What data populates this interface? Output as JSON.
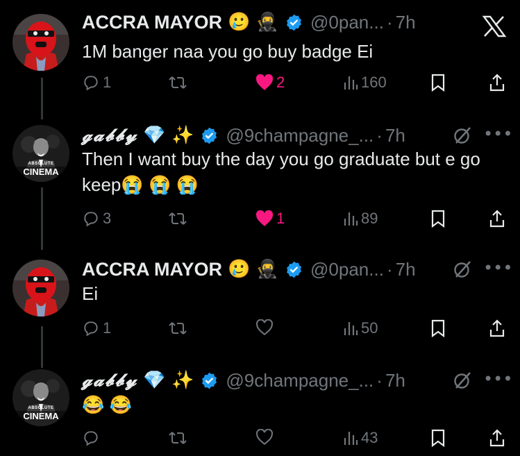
{
  "close_icon": "x-logo",
  "tweets": [
    {
      "name": "ACCRA MAYOR",
      "emojis": "🥲 🥷",
      "handle": "@0pan...",
      "dot": "·",
      "time": "7h",
      "text": "1M banger naa you go buy badge Ei",
      "replies": "1",
      "reposts": "",
      "likes": "2",
      "liked": true,
      "views": "160"
    },
    {
      "name": "𝓰𝓪𝓫𝓫𝔂",
      "emojis": "💎 ✨",
      "handle": "@9champagne_...",
      "dot": "·",
      "time": "7h",
      "text": "Then I want buy the day you go graduate but e go keep😭 😭 😭",
      "replies": "3",
      "reposts": "",
      "likes": "1",
      "liked": true,
      "views": "89",
      "avatar_caption_small": "ABSOLUTE",
      "avatar_caption": "CINEMA"
    },
    {
      "name": "ACCRA MAYOR",
      "emojis": "🥲 🥷",
      "handle": "@0pan...",
      "dot": "·",
      "time": "7h",
      "text": "Ei",
      "replies": "1",
      "reposts": "",
      "likes": "",
      "liked": false,
      "views": "50"
    },
    {
      "name": "𝓰𝓪𝓫𝓫𝔂",
      "emojis": "💎 ✨",
      "handle": "@9champagne_...",
      "dot": "·",
      "time": "7h",
      "text": "😂 😂",
      "replies": "",
      "reposts": "",
      "likes": "",
      "liked": false,
      "views": "43",
      "avatar_caption_small": "ABSOLUTE",
      "avatar_caption": "CINEMA"
    }
  ],
  "colors": {
    "background": "#000000",
    "text": "#e7e9ea",
    "muted": "#71767b",
    "like": "#f91880",
    "verified": "#1d9bf0"
  }
}
